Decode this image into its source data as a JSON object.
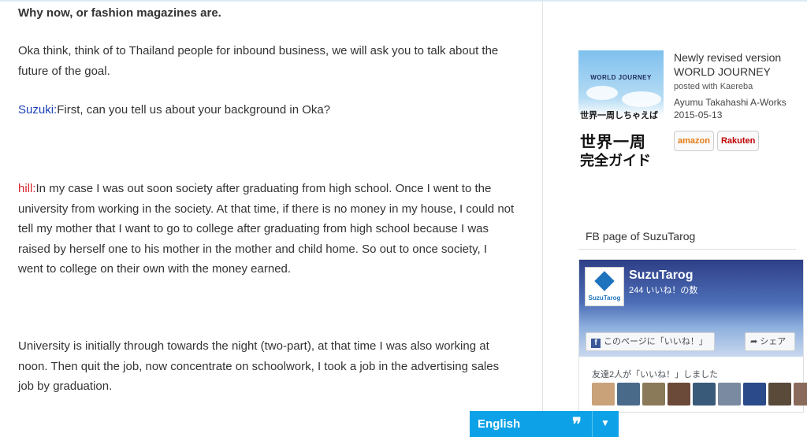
{
  "article": {
    "heading": "Why now, or fashion magazines are.",
    "p1": "Oka think, think of to Thailand people for inbound business, we will ask you to talk about the future of the goal.",
    "p2_speaker": "Suzuki:",
    "p2_text": "First, can you tell us about your background in Oka?",
    "p3_speaker": "hill:",
    "p3_text": "In my case I was out soon society after graduating from high school. Once I went to the university from working in the society. At that time, if there is no money in my house, I could not tell my mother that I want to go to college after graduating from high school because I was raised by herself one to his mother in the mother and child home. So out to once society, I went to college on their own with the money earned.",
    "p4": "University is initially through towards the night (two-part), at that time I was also working at noon. Then quit the job, now concentrate on schoolwork, I took a job in the advertising sales job by graduation."
  },
  "book": {
    "cover_title": "WORLD JOURNEY",
    "cover_jp1": "世界一周しちゃえば",
    "cover_jp2": "世界一周",
    "cover_jp3": "完全ガイド",
    "title": "Newly revised version WORLD JOURNEY",
    "posted": "posted with Kaereba",
    "author": "Ayumu Takahashi A-Works",
    "date": "2015-05-13",
    "amazon": "amazon",
    "rakuten": "Rakuten"
  },
  "fb": {
    "heading": "FB page of SuzuTarog",
    "page_name": "SuzuTarog",
    "logo_label": "SuzuTarog",
    "likes": "244 いいね！の数",
    "like_button": "このページに「いいね！」",
    "share_button": "シェア",
    "friends_text": "友達2人が「いいね！」しました",
    "face_colors": [
      "#c9a27a",
      "#4a6a8a",
      "#8a7a5a",
      "#6b4a3a",
      "#3a5a7a",
      "#7a8aa0",
      "#2a4a8a",
      "#5a4a3a",
      "#8a6a5a"
    ]
  },
  "translator": {
    "language": "English",
    "quote_icon": "❞",
    "arrow": "▼"
  }
}
